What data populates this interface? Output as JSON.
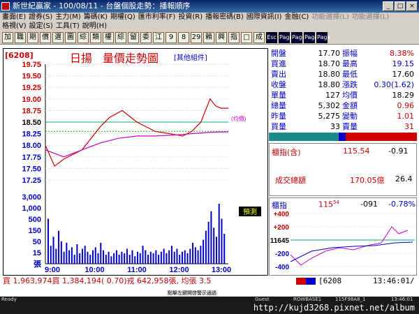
{
  "window": {
    "title": "新世紀贏家 - 100/08/11 - 台盤個股走勢：播報順序",
    "min": "_",
    "max": "□",
    "close": "×"
  },
  "menu": {
    "row1": [
      "畫面(E)",
      "證券(S)",
      "主力(M)",
      "籌碼(K)",
      "期權(Q)",
      "匯市利率(F)",
      "投資(R)",
      "播報密碼(B)",
      "國際資訊(I)",
      "金融(C)",
      "功能選擇(L)",
      "功能選擇(L)"
    ],
    "row2": [
      "格視(V)",
      "設定(S)",
      "工具(T)",
      "說明(H)"
    ]
  },
  "toolbar": [
    "加",
    "職",
    "期",
    "價",
    "選",
    "圖",
    "綜",
    "類",
    "權",
    "綜",
    "留",
    "委",
    "江",
    "9",
    "8",
    "29",
    "賴",
    "興",
    "指",
    "□",
    "成",
    "Esc",
    "Page",
    "Page",
    "Page",
    "Page"
  ],
  "header": {
    "code": "[6208]",
    "name": "日揚",
    "title": "量價走勢圖",
    "component": "[其他組件]"
  },
  "chart_data": {
    "type": "line",
    "xlabels": [
      "9:00",
      "10:00",
      "11:00",
      "12:00",
      "13:00"
    ],
    "price_ticks": [
      "19.75",
      "19.50",
      "19.25",
      "19.00",
      "18.75",
      "18.50",
      "18.25",
      "18.00",
      "17.75",
      "17.50",
      "17.25"
    ],
    "vol_ticks": [
      "3,000",
      "1,000",
      "500",
      "150",
      "50",
      "15",
      "張"
    ],
    "ref_price": 18.5,
    "ylim": [
      17.25,
      19.75
    ],
    "prediction_label": "預測",
    "avg_label": "(均價)",
    "series": [
      {
        "name": "price",
        "x": [
          0,
          0.05,
          0.1,
          0.2,
          0.3,
          0.35,
          0.42,
          0.5,
          0.55,
          0.6,
          0.68,
          0.75,
          0.8,
          0.85,
          0.9,
          0.93,
          0.96,
          1.0
        ],
        "values": [
          18.0,
          17.55,
          17.7,
          17.9,
          18.4,
          18.6,
          18.75,
          18.5,
          18.4,
          18.3,
          18.25,
          18.2,
          18.3,
          18.5,
          19.0,
          18.85,
          18.8,
          18.8
        ]
      },
      {
        "name": "avg",
        "x": [
          0,
          0.1,
          0.2,
          0.3,
          0.4,
          0.5,
          0.6,
          0.7,
          0.8,
          0.9,
          1.0
        ],
        "values": [
          17.9,
          17.75,
          17.9,
          18.05,
          18.15,
          18.2,
          18.2,
          18.22,
          18.25,
          18.28,
          18.29
        ]
      }
    ],
    "volume": [
      30,
      12,
      18,
      10,
      22,
      15,
      8,
      14,
      9,
      11,
      6,
      13,
      7,
      10,
      12,
      8,
      6,
      9,
      11,
      7,
      14,
      9,
      6,
      8,
      5,
      7,
      9,
      6,
      8,
      7,
      10,
      6,
      9,
      5,
      8,
      7,
      12,
      9,
      6,
      8,
      7,
      9,
      6,
      8,
      10,
      7,
      9,
      12,
      8,
      10,
      6,
      8,
      9,
      7,
      10,
      14,
      11,
      9,
      12,
      16,
      22,
      28,
      35,
      24,
      18,
      40,
      30,
      20
    ]
  },
  "quotes": [
    {
      "l": "開盤",
      "v": "17.70",
      "l2": "振幅",
      "v2": "8.38%",
      "v2c": "red"
    },
    {
      "l": "買進",
      "v": "18.70",
      "l2": "最高",
      "v2": "19.15",
      "v2c": "bluev"
    },
    {
      "l": "賣出",
      "v": "18.80",
      "l2": "最低",
      "v2": "17.60",
      "v2c": ""
    },
    {
      "l": "收盤",
      "v": "18.80",
      "l2": "漲跌",
      "v2": "0.30(1.62)",
      "v2c": "bluev"
    },
    {
      "l": "單量",
      "v": "127",
      "l2": "均價",
      "v2": "18.29",
      "v2c": ""
    },
    {
      "l": "總量",
      "v": "5,302",
      "l2": "金額",
      "v2": "0.96",
      "v2c": "red"
    },
    {
      "l": "昨量",
      "v": "5,275",
      "l2": "變動",
      "v2": "1.01",
      "v2c": "red"
    },
    {
      "l": "買量",
      "v": "33",
      "l2": "賣量",
      "v2": "31",
      "v2c": "red"
    }
  ],
  "index": {
    "label": "櫃指(含)",
    "value": "115.54",
    "change": "-0.91",
    "total_label": "成交總額",
    "total": "170.05億",
    "total2": "26.4"
  },
  "mini": {
    "label": "櫃指",
    "value": "115",
    "value_sup": "54",
    "change": "-091",
    "pct": "-0.78%",
    "ticks": [
      "+400",
      "+200",
      "11645",
      "-200",
      "-400"
    ]
  },
  "bottom": {
    "text": "買 1,963,974買 1,384,194( 0.70)戎 642,958張, 均張 3.5",
    "code": "[6208",
    "time": "13:46:01/"
  },
  "status": {
    "ready": "Ready",
    "guest": "Guest",
    "row": "ROWBASE1",
    "build": "115F98A8_1",
    "time": "13:46:01",
    "hint": "點擊左鍵開啓警示通過",
    "watermark": "http://kujd3268.pixnet.net/album"
  }
}
